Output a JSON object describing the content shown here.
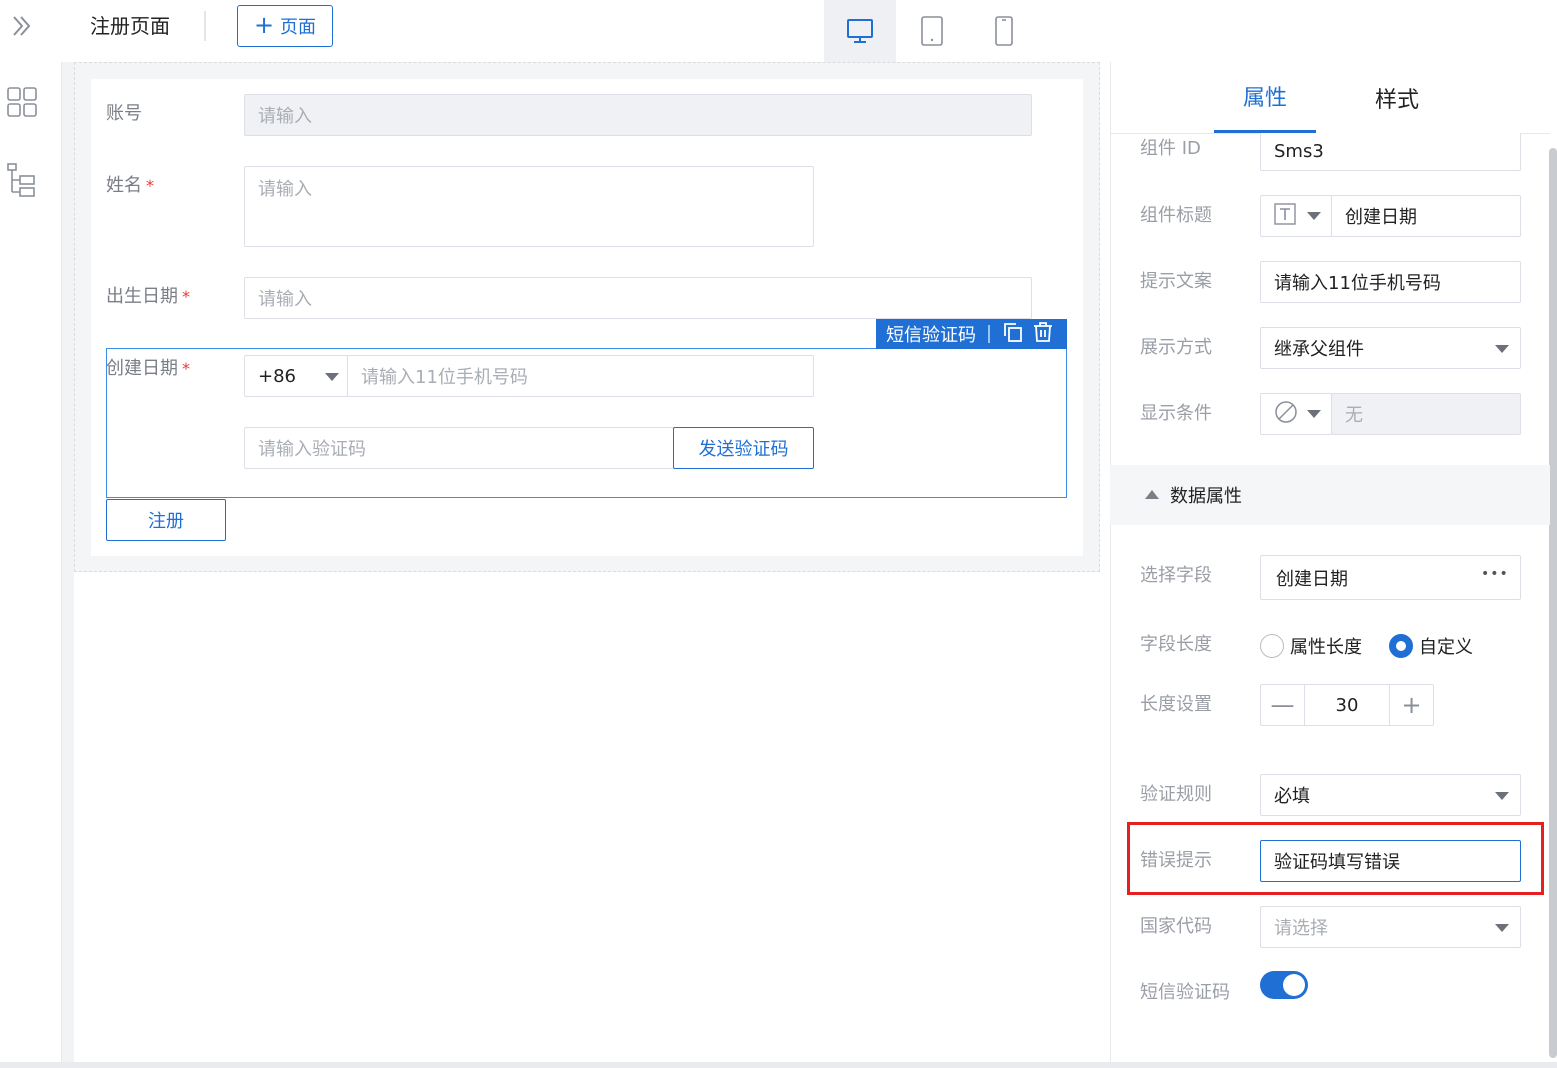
{
  "topbar": {
    "page_title": "注册页面",
    "add_page_label": "页面",
    "add_page_plus": "+"
  },
  "form": {
    "account": {
      "label": "账号",
      "placeholder": "请输入"
    },
    "name": {
      "label": "姓名",
      "required": "*",
      "placeholder": "请输入"
    },
    "birth_date": {
      "label": "出生日期",
      "required": "*",
      "placeholder": "请输入"
    },
    "create_date": {
      "label": "创建日期",
      "required": "*"
    },
    "sms": {
      "tag_label": "短信验证码",
      "country_code": "+86",
      "phone_placeholder": "请输入11位手机号码",
      "code_placeholder": "请输入验证码",
      "send_code_label": "发送验证码"
    },
    "register_label": "注册"
  },
  "panel": {
    "tabs": {
      "properties": "属性",
      "style": "样式"
    },
    "component_id": {
      "label": "组件 ID",
      "value": "Sms3"
    },
    "component_title": {
      "label": "组件标题",
      "value": "创建日期"
    },
    "hint_text": {
      "label": "提示文案",
      "value": "请输入11位手机号码"
    },
    "display_mode": {
      "label": "展示方式",
      "value": "继承父组件"
    },
    "display_condition": {
      "label": "显示条件",
      "value": "无"
    },
    "data_section": {
      "title": "数据属性"
    },
    "select_field": {
      "label": "选择字段",
      "value": "创建日期",
      "more": "•••"
    },
    "field_length": {
      "label": "字段长度",
      "options": [
        "属性长度",
        "自定义"
      ],
      "selected": "自定义"
    },
    "length_setting": {
      "label": "长度设置",
      "value": "30",
      "minus": "—",
      "plus": "+"
    },
    "validation_rule": {
      "label": "验证规则",
      "value": "必填"
    },
    "error_hint": {
      "label": "错误提示",
      "value": "验证码填写错误"
    },
    "country_code": {
      "label": "国家代码",
      "placeholder": "请选择"
    },
    "sms_code": {
      "label": "短信验证码",
      "enabled": true
    }
  },
  "colors": {
    "accent": "#1f6fd4",
    "required": "#e5393a",
    "highlight": "#e62020"
  }
}
